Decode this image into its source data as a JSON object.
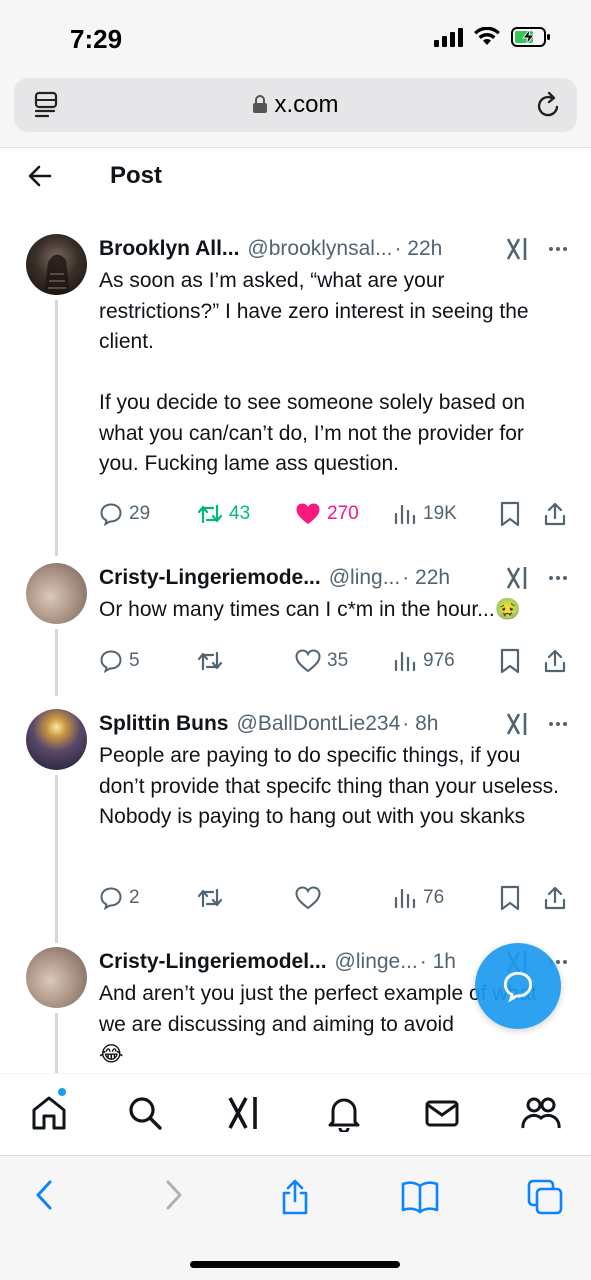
{
  "status_bar": {
    "time": "7:29"
  },
  "browser": {
    "url": "x.com"
  },
  "header": {
    "title": "Post"
  },
  "tweets": [
    {
      "name": "Brooklyn All...",
      "handle": "@brooklynsal...",
      "time": "· 22h",
      "text": "As soon as I’m asked, “what are your restrictions?” I have zero interest in seeing the client.\n\nIf you decide to see someone solely based on what you can/can’t do, I’m not the provider for you. Fucking lame ass question.",
      "replies": "29",
      "reposts": "43",
      "likes": "270",
      "views": "19K"
    },
    {
      "name": "Cristy-Lingeriemode...",
      "handle": "@ling...",
      "time": "· 22h",
      "text": "Or how many times can I c*m in the hour...🤢",
      "replies": "5",
      "reposts": "",
      "likes": "35",
      "views": "976"
    },
    {
      "name": "Splittin Buns",
      "handle": "@BallDontLie234",
      "time": "· 8h",
      "text": "People are paying to do specific things, if you don’t provide that specifc thing than your useless. Nobody is paying to hang out with you skanks",
      "replies": "2",
      "reposts": "",
      "likes": "",
      "views": "76"
    },
    {
      "name": "Cristy-Lingeriemodel...",
      "handle": "@linge...",
      "time": "· 1h",
      "text": "And aren’t you just the perfect example of what we are discussing and aiming to avoid\n😂"
    }
  ],
  "colors": {
    "accent": "#1d9bf0",
    "repost_active": "#00ba7c",
    "like_active": "#f91880",
    "secondary_text": "#536471"
  },
  "icons": {
    "tab_bar": [
      "home-icon",
      "search-icon",
      "grok-icon",
      "notifications-icon",
      "messages-icon",
      "communities-icon"
    ],
    "safari_bar": [
      "back-icon",
      "forward-icon",
      "share-icon",
      "bookmarks-icon",
      "tabs-icon"
    ]
  }
}
